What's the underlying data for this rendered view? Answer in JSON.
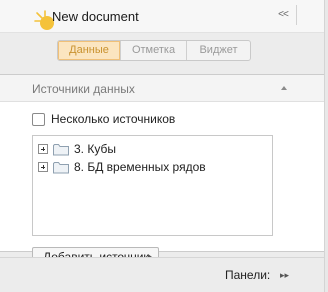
{
  "window": {
    "title": "New document",
    "collapse_glyph": "<<",
    "icon": "sun-icon"
  },
  "tabs": [
    {
      "label": "Данные",
      "active": true
    },
    {
      "label": "Отметка",
      "active": false
    },
    {
      "label": "Виджет",
      "active": false
    }
  ],
  "data_sources": {
    "title": "Источники данных",
    "multi_sources_label": "Несколько источников",
    "multi_sources_checked": false,
    "items": [
      {
        "label": "3. Кубы",
        "icon": "folder-icon",
        "expanded": false
      },
      {
        "label": "8. БД временных рядов",
        "icon": "folder-icon",
        "expanded": false
      }
    ],
    "add_button_label": "Добавить источник"
  },
  "footer": {
    "panels_label": "Панели:",
    "arrows_glyph": "▸▸"
  },
  "colors": {
    "active_tab_bg": "#fbe5c0",
    "active_tab_text": "#c9922f",
    "panel_bg": "#ececec"
  }
}
